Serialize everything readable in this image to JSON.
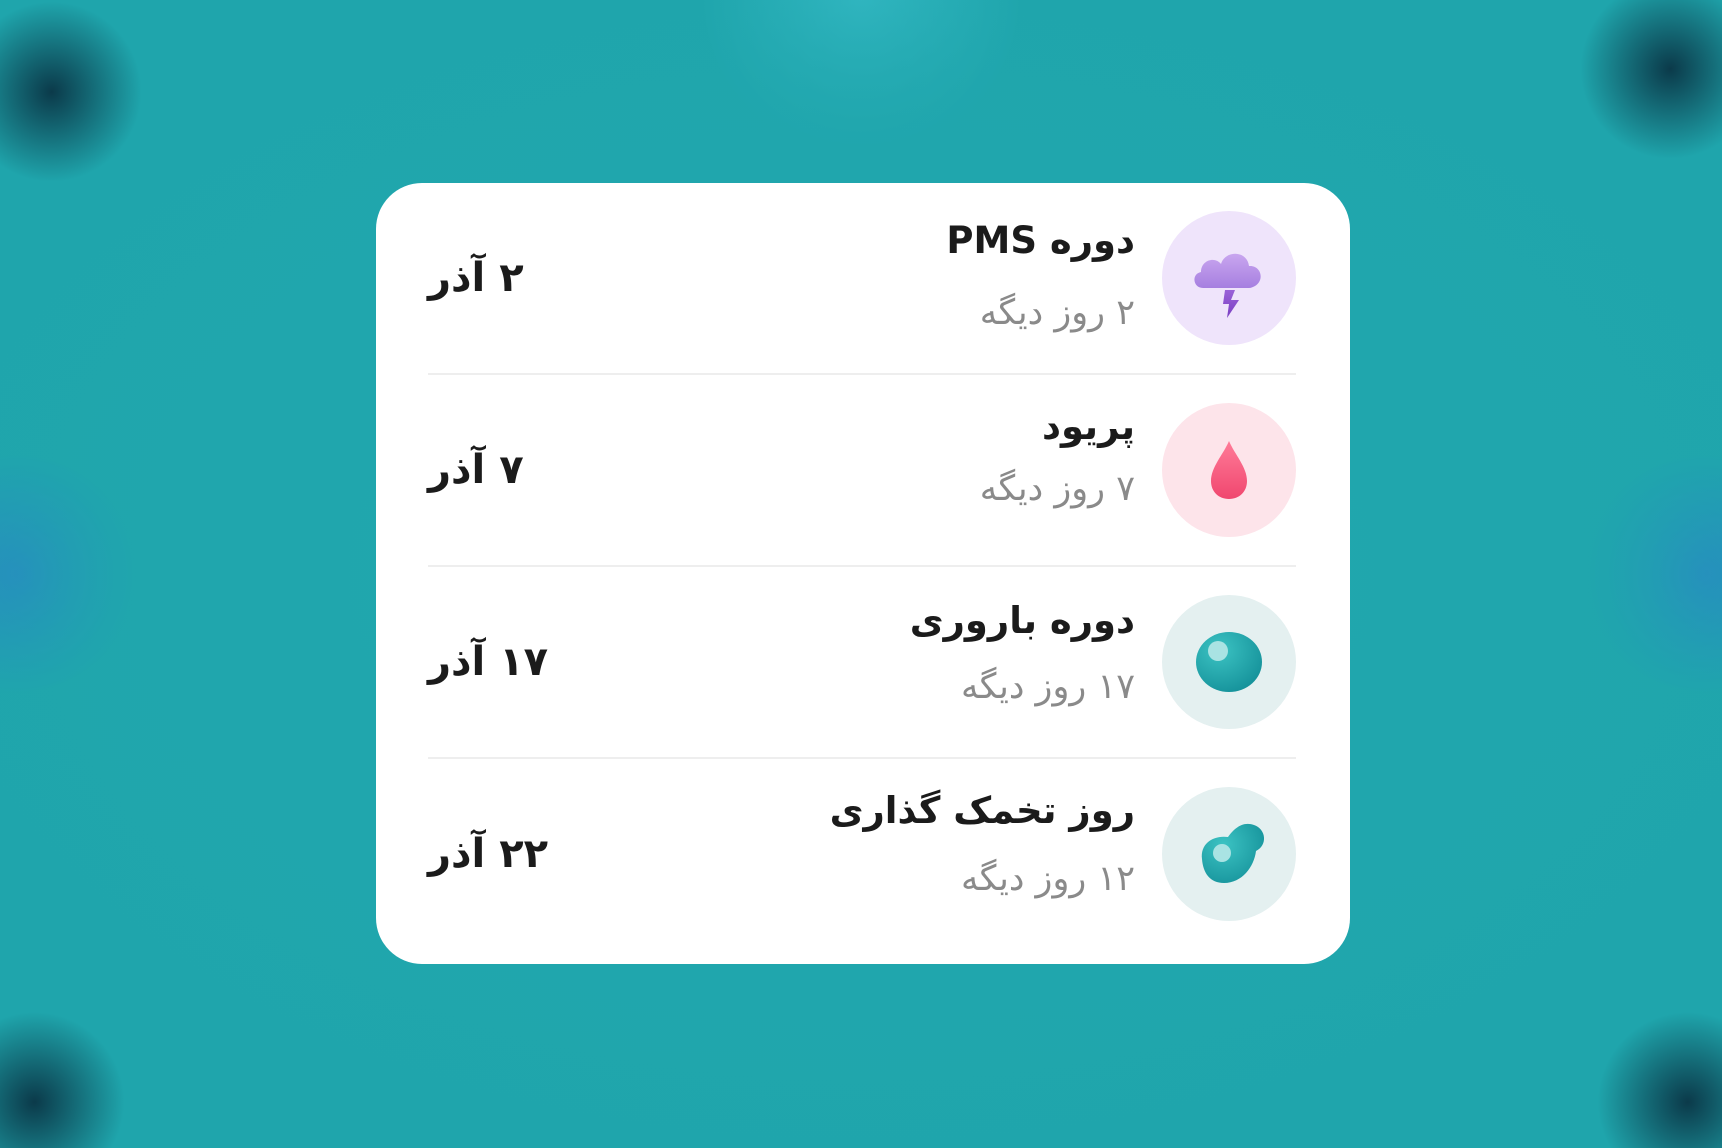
{
  "colors": {
    "background": "#1fa5ac",
    "card": "#ffffff",
    "pms_circle": "#efe4fb",
    "period_circle": "#fde4ea",
    "fertile_circle": "#e4f0f0",
    "ovulation_circle": "#e4f0f0"
  },
  "events": [
    {
      "title": "دوره PMS",
      "subtitle": "۲ روز دیگه",
      "date": "۲ آذر",
      "icon": "storm-cloud-icon"
    },
    {
      "title": "پریود",
      "subtitle": "۷ روز دیگه",
      "date": "۷ آذر",
      "icon": "blood-drop-icon"
    },
    {
      "title": "دوره باروری",
      "subtitle": "۱۷ روز دیگه",
      "date": "۱۷ آذر",
      "icon": "egg-cell-icon"
    },
    {
      "title": "روز تخمک گذاری",
      "subtitle": "۱۲ روز دیگه",
      "date": "۲۲ آذر",
      "icon": "ovulation-cell-icon"
    }
  ]
}
